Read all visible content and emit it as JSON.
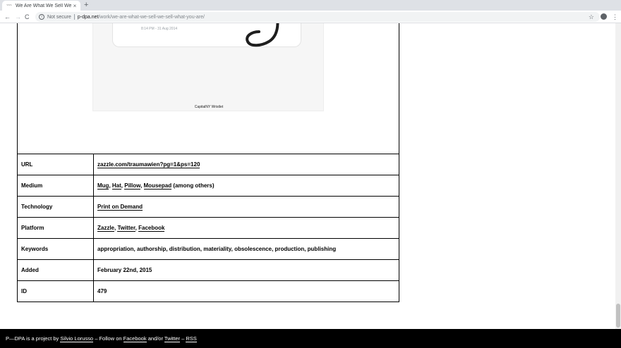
{
  "browser": {
    "tab_title": "We Are What We Sell We S",
    "tab_favicon": "~~~",
    "new_tab_glyph": "+",
    "close_glyph": "×",
    "back_glyph": "←",
    "forward_glyph": "→",
    "reload_glyph": "C",
    "security_label": "Not secure",
    "url_host": "p-dpa.net",
    "url_path": "/work/we-are-what-we-sell-we-sell-what-you-are/",
    "bookmark_glyph": "☆",
    "menu_glyph": "⋮"
  },
  "product": {
    "date_text": "8:14 PM - 31 Aug 2014",
    "caption": "CapitalNY Wristlet"
  },
  "details": {
    "url": {
      "label": "URL",
      "value": "zazzle.com/traumawien?pg=1&ps=120"
    },
    "medium": {
      "label": "Medium",
      "items": [
        "Mug",
        "Hat",
        "Pillow",
        "Mousepad"
      ],
      "suffix": "(among others)"
    },
    "technology": {
      "label": "Technology",
      "value": "Print on Demand"
    },
    "platform": {
      "label": "Platform",
      "items": [
        "Zazzle",
        "Twitter",
        "Facebook"
      ]
    },
    "keywords": {
      "label": "Keywords",
      "value": "appropriation, authorship, distribution, materiality, obsolescence, production, publishing"
    },
    "added": {
      "label": "Added",
      "value": "February 22nd, 2015"
    },
    "id": {
      "label": "ID",
      "value": "479"
    }
  },
  "footer": {
    "text1": "P—DPA is a project by",
    "author": "Silvio Lorusso",
    "text2": "– Follow on",
    "facebook": "Facebook",
    "text3": "and/or",
    "twitter": "Twitter",
    "text4": "–",
    "rss": "RSS"
  },
  "colors": {
    "footer_bg": "#000000",
    "tabstrip_bg": "#dee1e6",
    "omnibox_bg": "#f1f3f4"
  }
}
